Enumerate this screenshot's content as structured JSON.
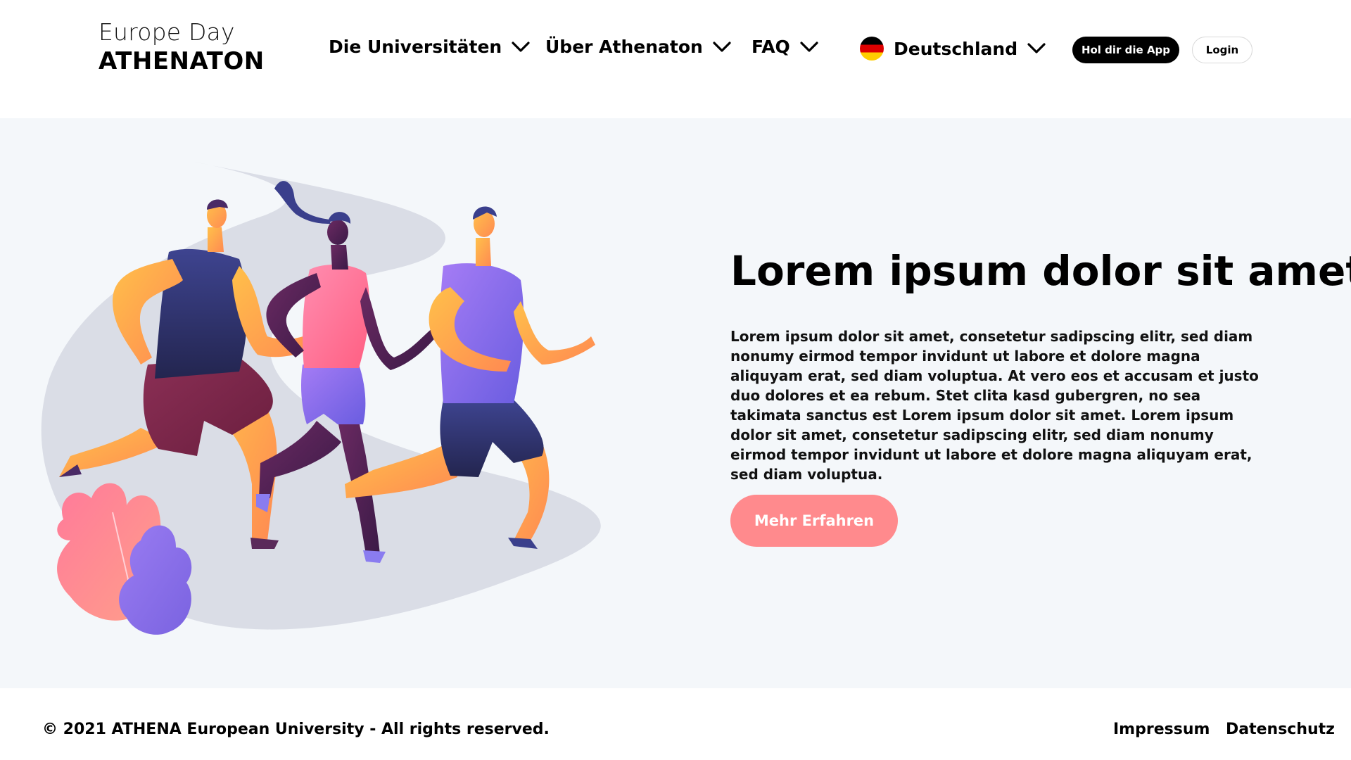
{
  "header": {
    "logo_top": "Europe Day",
    "logo_bottom": "ATHENATON",
    "nav": [
      {
        "label": "Die Universitäten"
      },
      {
        "label": "Über Athenaton"
      },
      {
        "label": "FAQ"
      },
      {
        "label": "Deutschland",
        "icon": "germany-flag-icon"
      }
    ],
    "app_button": "Hol dir die App",
    "login_button": "Login"
  },
  "hero": {
    "title": "Lorem ipsum dolor sit amet",
    "text": "Lorem ipsum dolor sit amet, consetetur sadipscing elitr, sed diam nonumy eirmod tempor invidunt ut labore et dolore magna aliquyam erat, sed diam voluptua. At vero eos et accusam et justo duo dolores et ea rebum. Stet clita kasd gubergren, no sea takimata sanctus est Lorem ipsum dolor sit amet. Lorem ipsum dolor sit amet, consetetur sadipscing elitr, sed diam nonumy eirmod tempor invidunt ut labore et dolore magna aliquyam erat, sed diam voluptua.",
    "button": "Mehr Erfahren",
    "illustration": "runners-illustration"
  },
  "footer": {
    "copyright": "© 2021 ATHENA European University - All rights reserved.",
    "links": [
      "Impressum",
      "Datenschutz"
    ]
  },
  "colors": {
    "accent": "#ff8a8d",
    "hero_bg": "#f4f7fa",
    "button_dark": "#000000"
  }
}
